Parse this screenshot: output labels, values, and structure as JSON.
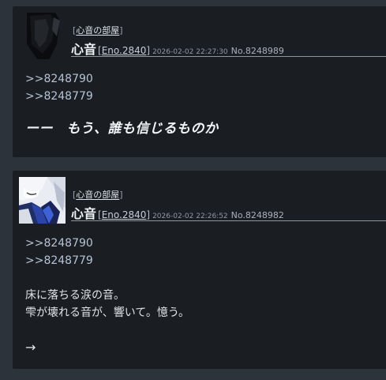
{
  "posts": [
    {
      "room_open": "[",
      "room_label": "心音の部屋",
      "room_close": "]",
      "name": "心音",
      "eno_open": "[",
      "eno": "Eno.2840",
      "eno_close": "]",
      "timestamp": "2026-02-02 22:27:30",
      "number": "No.8248989",
      "anchors": [
        ">>8248790",
        ">>8248779"
      ],
      "headline": "ーー　もう、誰も信じるものか"
    },
    {
      "room_open": "[",
      "room_label": "心音の部屋",
      "room_close": "]",
      "name": "心音",
      "eno_open": "[",
      "eno": "Eno.2840",
      "eno_close": "]",
      "timestamp": "2026-02-02 22:26:52",
      "number": "No.8248982",
      "anchors": [
        ">>8248790",
        ">>8248779"
      ],
      "lines": [
        "床に落ちる涙の音。",
        "雫が壊れる音が、響いて。憶う。"
      ],
      "arrow": "→"
    }
  ]
}
